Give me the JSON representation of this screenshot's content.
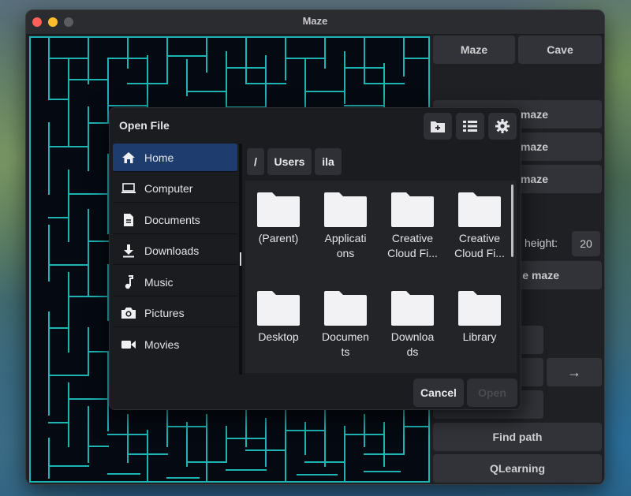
{
  "window": {
    "title": "Maze"
  },
  "right_panel": {
    "tab_maze": "Maze",
    "tab_cave": "Cave",
    "btn_1": "maze",
    "btn_2": "maze",
    "btn_3": "maze",
    "height_label": "height:",
    "height_value": "20",
    "btn_4": "e maze",
    "arrow_right": "→",
    "find_path": "Find path",
    "qlearning": "QLearning"
  },
  "dialog": {
    "title": "Open File",
    "header_icons": [
      "new-folder-icon",
      "list-view-icon",
      "gear-icon"
    ],
    "sidebar": [
      {
        "label": "Home",
        "icon": "home-icon",
        "active": true
      },
      {
        "label": "Computer",
        "icon": "laptop-icon"
      },
      {
        "label": "Documents",
        "icon": "document-icon"
      },
      {
        "label": "Downloads",
        "icon": "download-icon"
      },
      {
        "label": "Music",
        "icon": "music-icon"
      },
      {
        "label": "Pictures",
        "icon": "camera-icon"
      },
      {
        "label": "Movies",
        "icon": "movie-icon"
      }
    ],
    "breadcrumb": [
      "/",
      "Users",
      "ila"
    ],
    "files": [
      {
        "line1": "(Parent)",
        "line2": ""
      },
      {
        "line1": "Applicati",
        "line2": "ons"
      },
      {
        "line1": "Creative",
        "line2": "Cloud Fi..."
      },
      {
        "line1": "Creative",
        "line2": "Cloud Fi..."
      },
      {
        "line1": "Desktop",
        "line2": ""
      },
      {
        "line1": "Documen",
        "line2": "ts"
      },
      {
        "line1": "Downloa",
        "line2": "ds"
      },
      {
        "line1": "Library",
        "line2": ""
      }
    ],
    "cancel": "Cancel",
    "open": "Open"
  },
  "colors": {
    "maze_wall": "#1fb4b4",
    "maze_bg": "#050a12",
    "accent": "#1e3d6e"
  }
}
